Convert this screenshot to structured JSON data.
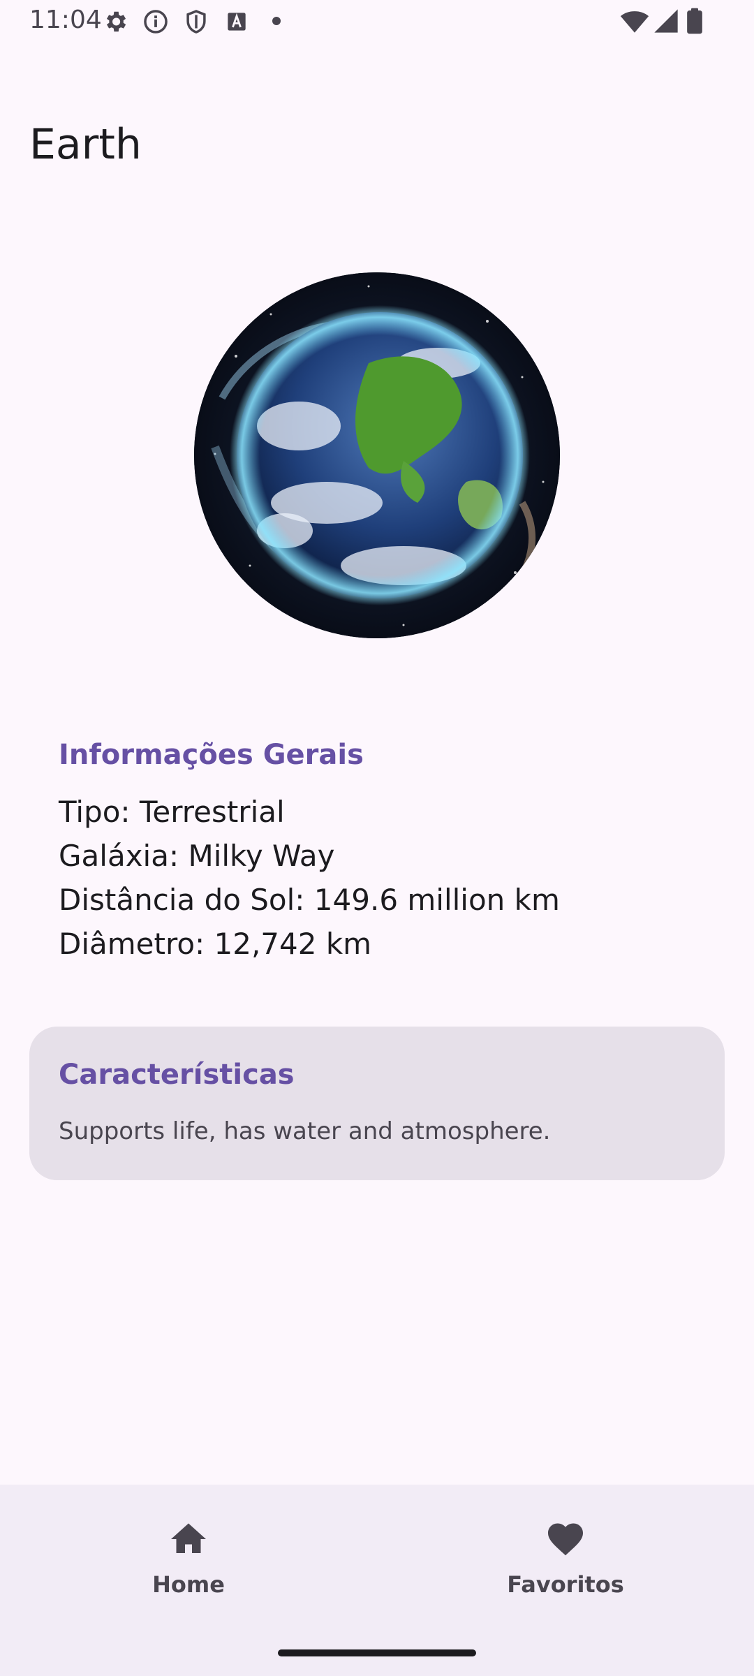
{
  "status_bar": {
    "time": "11:04",
    "icons": [
      "gear-icon",
      "info-icon",
      "shield-icon",
      "font-icon",
      "wifi-icon",
      "signal-icon",
      "battery-icon"
    ]
  },
  "page": {
    "title": "Earth",
    "image_icon": "earth-planet-image"
  },
  "general_info": {
    "title": "Informações Gerais",
    "lines": [
      "Tipo: Terrestrial",
      "Galáxia: Milky Way",
      "Distância do Sol: 149.6 million km",
      "Diâmetro: 12,742 km"
    ]
  },
  "characteristics": {
    "title": "Características",
    "text": "Supports life, has water and atmosphere."
  },
  "bottom_nav": {
    "items": [
      {
        "label": "Home",
        "icon": "home-icon"
      },
      {
        "label": "Favoritos",
        "icon": "heart-icon"
      }
    ]
  },
  "colors": {
    "accent": "#6650a4",
    "background": "#fdf7fd",
    "card": "#e6e0e9",
    "nav": "#f2ecf6"
  }
}
